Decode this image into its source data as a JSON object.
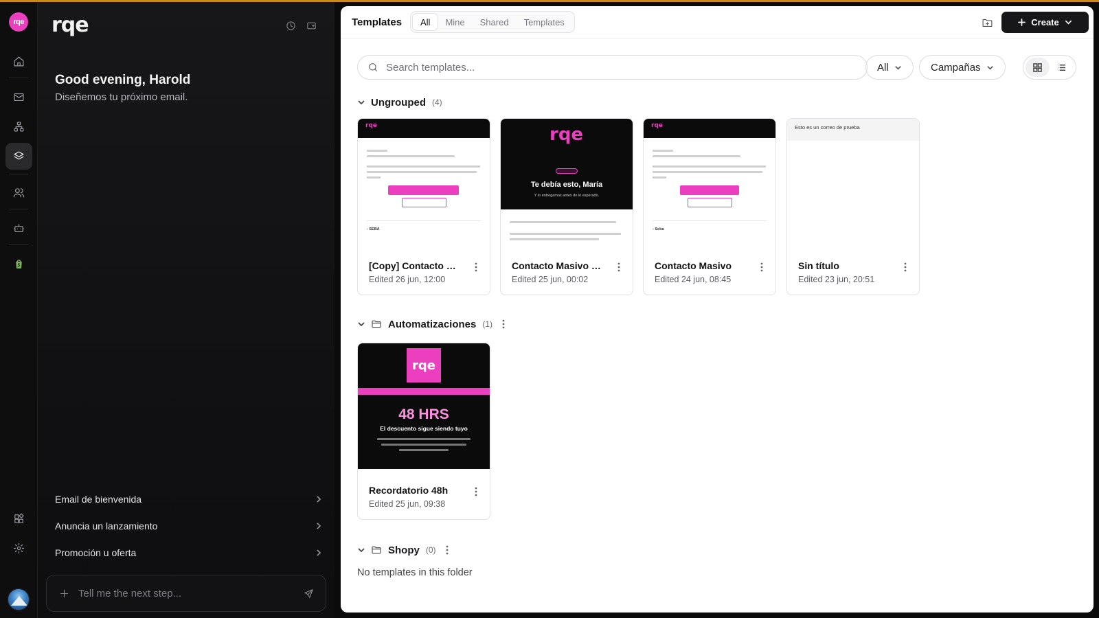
{
  "sidebar_nav": {
    "items": [
      {
        "name": "home-icon"
      },
      {
        "name": "mail-icon"
      },
      {
        "name": "flows-icon"
      },
      {
        "name": "layers-icon",
        "active": true
      },
      {
        "name": "users-icon"
      },
      {
        "name": "bot-icon"
      },
      {
        "name": "shopify-icon"
      }
    ],
    "bottom": [
      {
        "name": "integrations-icon"
      },
      {
        "name": "settings-icon"
      }
    ]
  },
  "chat": {
    "brand": "rqe",
    "greeting": "Good evening, Harold",
    "subtitle": "Diseñemos tu próximo email.",
    "suggestions": [
      "Email de bienvenida",
      "Anuncia un lanzamiento",
      "Promoción u oferta"
    ],
    "composer_placeholder": "Tell me the next step..."
  },
  "main": {
    "title": "Templates",
    "tabs": [
      "All",
      "Mine",
      "Shared",
      "Templates"
    ],
    "active_tab": "All",
    "create_label": "Create",
    "search_placeholder": "Search templates...",
    "filter_all": "All",
    "filter_type": "Campañas",
    "groups": [
      {
        "name": "Ungrouped",
        "count": "(4)"
      },
      {
        "name": "Automatizaciones",
        "count": "(1)"
      },
      {
        "name": "Shopy",
        "count": "(0)"
      }
    ],
    "cards": [
      {
        "name": "[Copy] Contacto Masivo",
        "date": "Edited 26 jun, 12:00"
      },
      {
        "name": "Contacto Masivo Tranquilo",
        "date": "Edited 25 jun, 00:02"
      },
      {
        "name": "Contacto Masivo",
        "date": "Edited 24 jun, 08:45"
      },
      {
        "name": "Sin título",
        "date": "Edited 23 jun, 20:51"
      },
      {
        "name": "Recordatorio 48h",
        "date": "Edited 25 jun, 09:38"
      }
    ],
    "thumbs": {
      "t2_title": "Te debía esto, María",
      "t2_sub": "Y lo entregamos antes de lo esperado.",
      "t4_text": "Esto es un correo de prueba",
      "t5_hrs": "48 HRS",
      "t5_sub": "El descuento sigue siendo tuyo"
    },
    "empty_text": "No templates in this folder"
  },
  "colors": {
    "accent": "#ec3fc0",
    "dark": "#17171a"
  }
}
